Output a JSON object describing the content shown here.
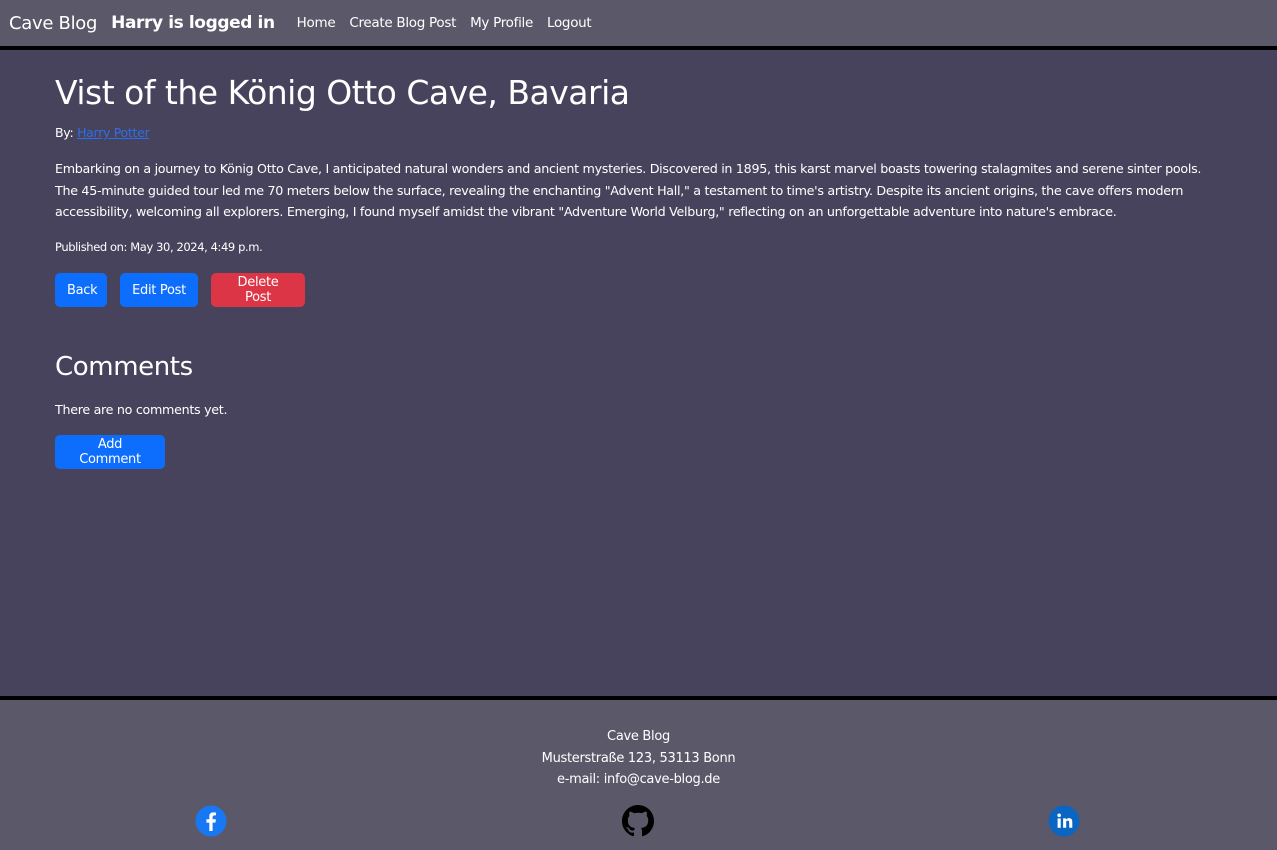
{
  "navbar": {
    "brand": "Cave Blog",
    "logged_in": "Harry is logged in",
    "links": [
      "Home",
      "Create Blog Post",
      "My Profile",
      "Logout"
    ]
  },
  "post": {
    "title": "Vist of the König Otto Cave, Bavaria",
    "by_label": "By:",
    "author": "Harry Potter",
    "body": "Embarking on a journey to König Otto Cave, I anticipated natural wonders and ancient mysteries. Discovered in 1895, this karst marvel boasts towering stalagmites and serene sinter pools. The 45-minute guided tour led me 70 meters below the surface, revealing the enchanting \"Advent Hall,\" a testament to time's artistry. Despite its ancient origins, the cave offers modern accessibility, welcoming all explorers. Emerging, I found myself amidst the vibrant \"Adventure World Velburg,\" reflecting on an unforgettable adventure into nature's embrace.",
    "published": "Published on: May 30, 2024, 4:49 p.m."
  },
  "actions": {
    "back": "Back",
    "edit": "Edit Post",
    "delete": "Delete Post"
  },
  "comments": {
    "title": "Comments",
    "empty_text": "There are no comments yet.",
    "add_label": "Add Comment"
  },
  "footer": {
    "name": "Cave Blog",
    "address": "Musterstraße 123, 53113 Bonn",
    "email": "e-mail: info@cave-blog.de",
    "social_icons": [
      "facebook-icon",
      "github-icon",
      "linkedin-icon"
    ]
  },
  "colors": {
    "navbar_bg": "#5b5869",
    "main_bg": "#47435c",
    "primary": "#0d6efd",
    "danger": "#dc3545",
    "link": "#2e6fe8"
  }
}
